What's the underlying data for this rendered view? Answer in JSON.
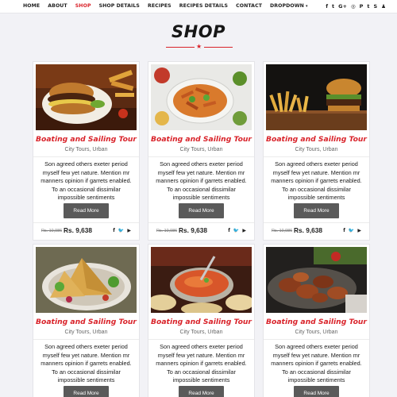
{
  "nav": {
    "items": [
      {
        "label": "HOME"
      },
      {
        "label": "ABOUT"
      },
      {
        "label": "SHOP"
      },
      {
        "label": "SHOP DETAILS"
      },
      {
        "label": "RECIPES"
      },
      {
        "label": "RECIPES DETAILS"
      },
      {
        "label": "CONTACT"
      },
      {
        "label": "DROPDOWN"
      }
    ],
    "active": "SHOP",
    "social_icons": [
      "facebook-icon",
      "twitter-icon",
      "google-plus-icon",
      "instagram-icon",
      "pinterest-icon",
      "tumblr-icon",
      "skype-icon",
      "snapchat-icon"
    ],
    "social_glyphs": [
      "f",
      "t",
      "G+",
      "◎",
      "P",
      "t",
      "S",
      "♟"
    ]
  },
  "page": {
    "title": "SHOP"
  },
  "colors": {
    "accent": "#d9232a",
    "button": "#5a5a5a",
    "background": "#f2f2f6"
  },
  "cards": [
    {
      "title": "Boating and Sailing Tour",
      "subtitle": "City  Tours, Urban",
      "description": "Son agreed others exeter period myself few yet nature. Mention mr manners opinion if garrets enabled. To an occasional dissimilar impossible sentiments",
      "button": "Read More",
      "old_price": "Rs. 10,986",
      "price": "Rs. 9,638",
      "image": "burger-plate"
    },
    {
      "title": "Boating and Sailing Tour",
      "subtitle": "City  Tours, Urban",
      "description": "Son agreed others exeter period myself few yet nature. Mention mr manners opinion if garrets enabled. To an occasional dissimilar impossible sentiments",
      "button": "Read More",
      "old_price": "Rs. 10,986",
      "price": "Rs. 9,638",
      "image": "chicken-salad-platter"
    },
    {
      "title": "Boating and Sailing Tour",
      "subtitle": "City  Tours, Urban",
      "description": "Son agreed others exeter period myself few yet nature. Mention mr manners opinion if garrets enabled. To an occasional dissimilar impossible sentiments",
      "button": "Read More",
      "old_price": "Rs. 10,986",
      "price": "Rs. 9,638",
      "image": "burger-and-fries"
    },
    {
      "title": "Boating and Sailing Tour",
      "subtitle": "City  Tours, Urban",
      "description": "Son agreed others exeter period myself few yet nature. Mention mr manners opinion if garrets enabled. To an occasional dissimilar impossible sentiments",
      "button": "Read More",
      "image": "samosa-plate"
    },
    {
      "title": "Boating and Sailing Tour",
      "subtitle": "City  Tours, Urban",
      "description": "Son agreed others exeter period myself few yet nature. Mention mr manners opinion if garrets enabled. To an occasional dissimilar impossible sentiments",
      "button": "Read More",
      "image": "curry-naan"
    },
    {
      "title": "Boating and Sailing Tour",
      "subtitle": "City  Tours, Urban",
      "description": "Son agreed others exeter period myself few yet nature. Mention mr manners opinion if garrets enabled. To an occasional dissimilar impossible sentiments",
      "button": "Read More",
      "image": "grilled-meat-platter"
    }
  ],
  "card_social_icons": [
    "facebook-icon",
    "twitter-icon",
    "youtube-icon"
  ],
  "card_social_glyphs": [
    "f",
    "🐦",
    "▶"
  ]
}
